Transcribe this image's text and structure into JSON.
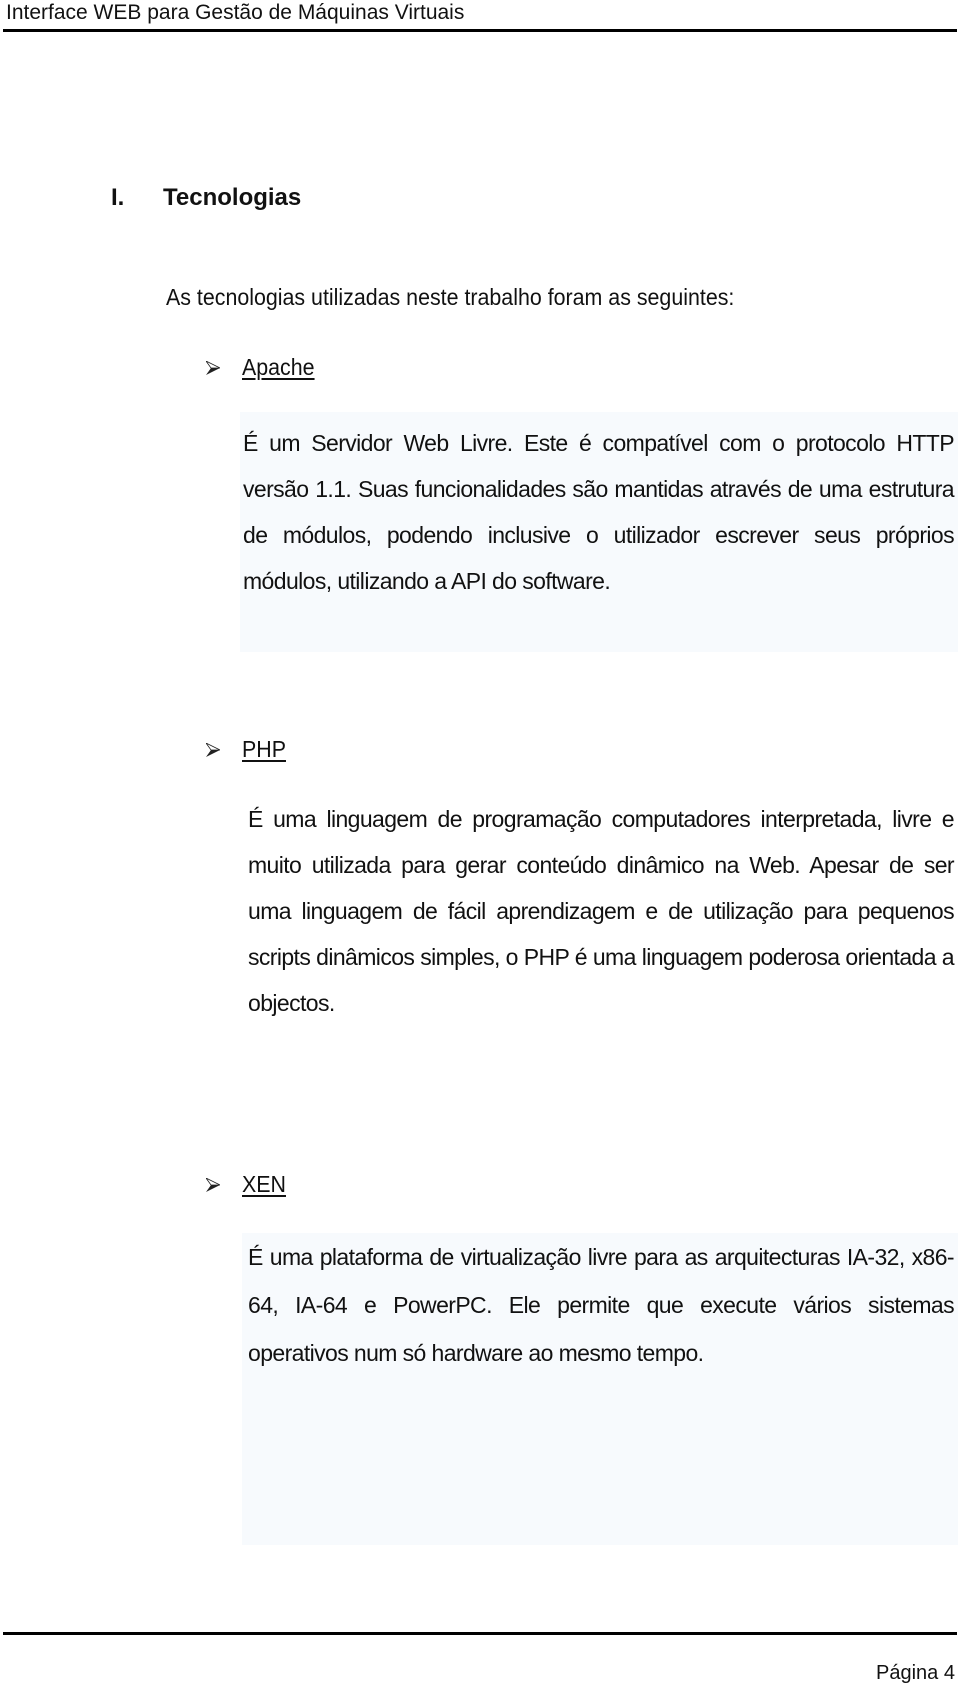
{
  "header": {
    "title": "Interface WEB para Gestão de Máquinas Virtuais"
  },
  "section": {
    "number": "I.",
    "title": "Tecnologias",
    "intro": "As tecnologias utilizadas neste trabalho foram as seguintes:"
  },
  "technologies": [
    {
      "name": "Apache",
      "icon": "arrowhead-bullet-icon",
      "description": "É um Servidor Web Livre. Este é compatível com o protocolo HTTP versão 1.1. Suas funcionalidades são mantidas através de uma estrutura de módulos, podendo inclusive o utilizador escrever seus próprios módulos, utilizando a API do software."
    },
    {
      "name": "PHP",
      "icon": "arrowhead-bullet-icon",
      "description": "É uma linguagem de programação computadores interpretada, livre e muito utilizada para gerar conteúdo dinâmico na Web. Apesar de ser uma linguagem de fácil aprendizagem e de utilização para pequenos scripts dinâmicos simples, o PHP é uma linguagem poderosa orientada a objectos."
    },
    {
      "name": "XEN",
      "icon": "arrowhead-bullet-icon",
      "description": "É uma plataforma de virtualização livre para as arquitecturas IA-32, x86-64, IA-64 e PowerPC. Ele permite que execute vários sistemas operativos num só hardware ao mesmo tempo."
    }
  ],
  "footer": {
    "page_label": "Página 4"
  }
}
